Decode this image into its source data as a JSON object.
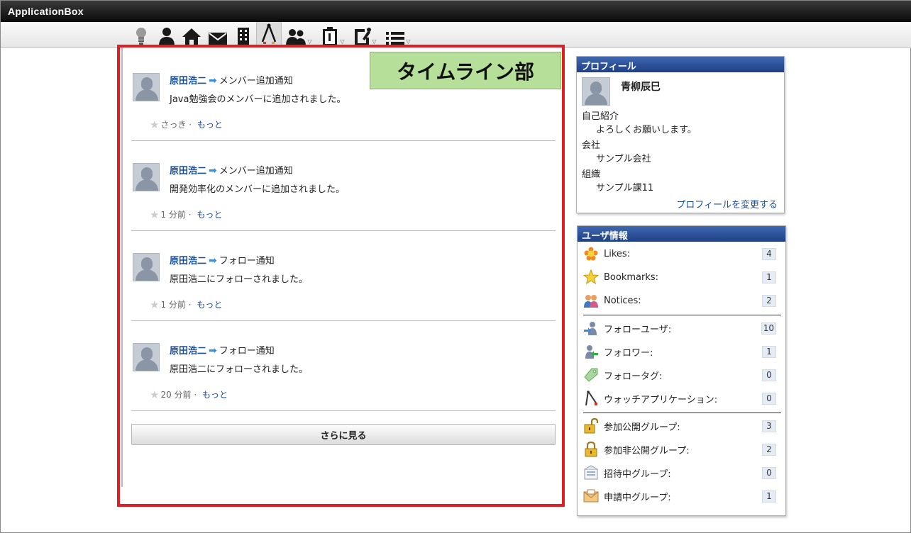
{
  "app": {
    "title": "ApplicationBox"
  },
  "toolbar": {
    "icons": [
      "lightbulb-icon",
      "user-icon",
      "home-icon",
      "mail-icon",
      "building-icon",
      "compass-icon",
      "users-icon",
      "clipboard-icon",
      "pin-icon",
      "list-icon"
    ]
  },
  "timeline": {
    "section_label": "タイムライン部",
    "entries": [
      {
        "user": "原田浩二",
        "type": "メンバー追加通知",
        "message": "Java勉強会のメンバーに追加されました。",
        "time": "さっき",
        "more": "もっと"
      },
      {
        "user": "原田浩二",
        "type": "メンバー追加通知",
        "message": "開発効率化のメンバーに追加されました。",
        "time": "1 分前",
        "more": "もっと"
      },
      {
        "user": "原田浩二",
        "type": "フォロー通知",
        "message": "原田浩二にフォローされました。",
        "time": "1 分前",
        "more": "もっと"
      },
      {
        "user": "原田浩二",
        "type": "フォロー通知",
        "message": "原田浩二にフォローされました。",
        "time": "20 分前",
        "more": "もっと"
      }
    ],
    "see_more": "さらに見る"
  },
  "profile": {
    "header": "プロフィール",
    "name": "青柳辰巳",
    "intro_label": "自己紹介",
    "intro_value": "よろしくお願いします。",
    "company_label": "会社",
    "company_value": "サンプル会社",
    "org_label": "組織",
    "org_value": "サンプル課11",
    "edit_link": "プロフィールを変更する"
  },
  "user_info": {
    "header": "ユーザ情報",
    "items": [
      {
        "label": "Likes:",
        "count": "4"
      },
      {
        "label": "Bookmarks:",
        "count": "1"
      },
      {
        "label": "Notices:",
        "count": "2"
      },
      {
        "label": "フォローユーザ:",
        "count": "10"
      },
      {
        "label": "フォロワー:",
        "count": "1"
      },
      {
        "label": "フォロータグ:",
        "count": "0"
      },
      {
        "label": "ウォッチアプリケーション:",
        "count": "0"
      },
      {
        "label": "参加公開グループ:",
        "count": "3"
      },
      {
        "label": "参加非公開グループ:",
        "count": "2"
      },
      {
        "label": "招待中グループ:",
        "count": "0"
      },
      {
        "label": "申請中グループ:",
        "count": "1"
      }
    ]
  }
}
